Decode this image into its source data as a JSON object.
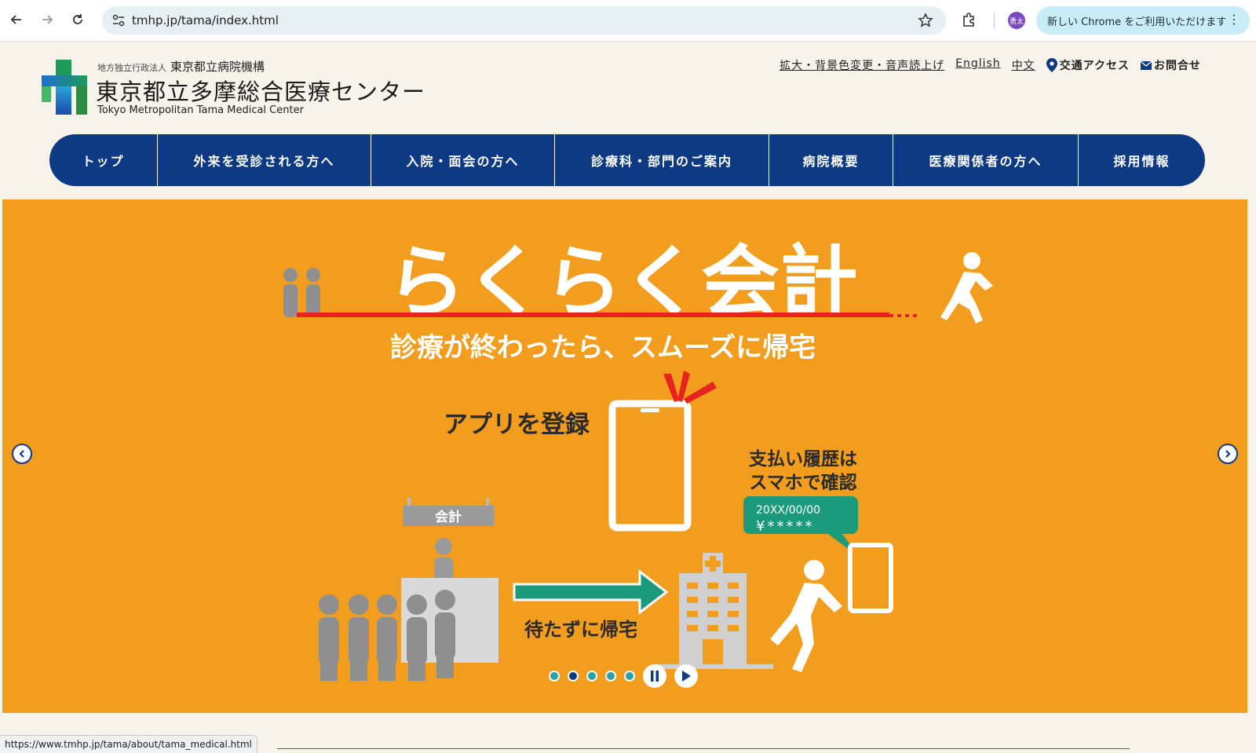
{
  "browser": {
    "url": "tmhp.jp/tama/index.html",
    "profile_badge": "勇太",
    "promo_text": "新しい Chrome をご利用いただけます",
    "icons": [
      "back-arrow-icon",
      "forward-arrow-icon",
      "reload-icon",
      "site-settings-icon",
      "star-icon",
      "extensions-icon",
      "kebab-menu-icon"
    ]
  },
  "header": {
    "org_small": "地方独立行政法人",
    "org_name": "東京都立病院機構",
    "title": "東京都立多摩総合医療センター",
    "subtitle": "Tokyo Metropolitan Tama Medical Center",
    "util_links": {
      "accessibility": "拡大・背景色変更・音声読上げ",
      "english": "English",
      "chinese": "中文",
      "access": "交通アクセス",
      "contact": "お問合せ"
    }
  },
  "gnav": {
    "items": [
      {
        "label": "トップ"
      },
      {
        "label": "外来を受診される方へ"
      },
      {
        "label": "入院・面会の方へ"
      },
      {
        "label": "診療科・部門のご案内"
      },
      {
        "label": "病院概要"
      },
      {
        "label": "医療関係者の方へ"
      },
      {
        "label": "採用情報"
      }
    ]
  },
  "slide": {
    "headline": "らくらく会計",
    "subhead": "診療が終わったら、スムーズに帰宅",
    "register_app": "アプリを登録",
    "history_line1": "支払い履歴は",
    "history_line2": "スマホで確認",
    "bubble_date": "20XX/00/00",
    "bubble_amount": "¥*****",
    "counter_sign": "会計",
    "go_home": "待たずに帰宅",
    "background_color": "#f29d1d",
    "total_slides": 5,
    "active_slide": 2
  },
  "status_bar": {
    "hover_url": "https://www.tmhp.jp/tama/about/tama_medical.html"
  }
}
